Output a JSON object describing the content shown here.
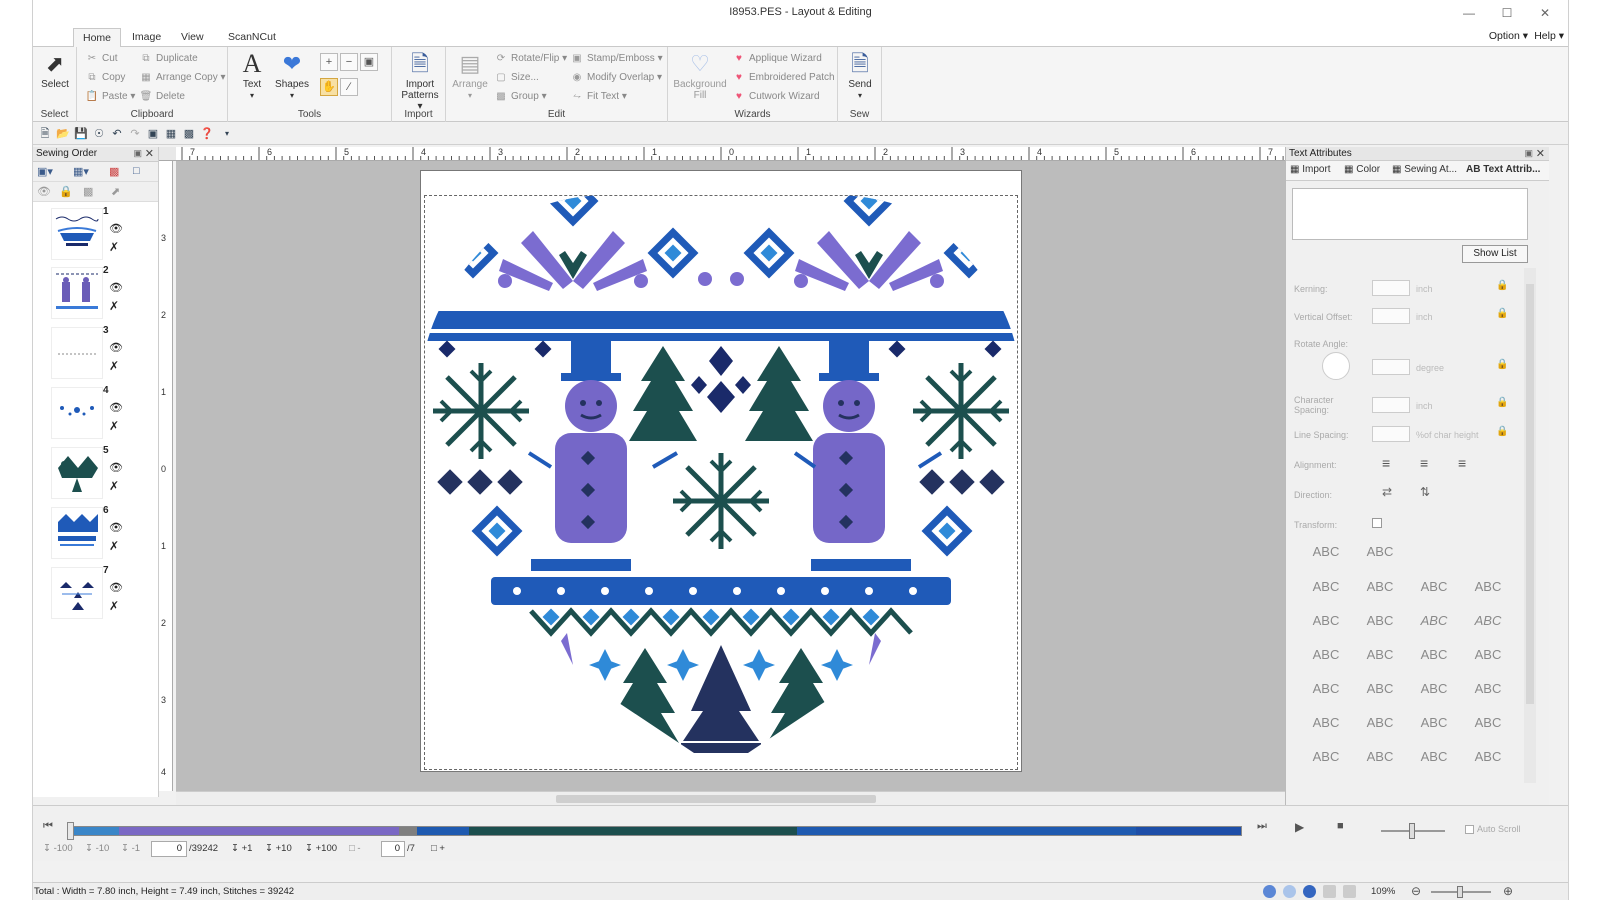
{
  "window": {
    "title": "I8953.PES - Layout & Editing"
  },
  "tabs": [
    "Home",
    "Image",
    "View",
    "ScanNCut"
  ],
  "menus": {
    "option": "Option",
    "help": "Help"
  },
  "ribbon": {
    "select": {
      "button": "Select",
      "group": "Select"
    },
    "clipboard": {
      "cut": "Cut",
      "copy": "Copy",
      "paste": "Paste",
      "duplicate": "Duplicate",
      "arrange_copy": "Arrange Copy",
      "delete": "Delete",
      "group": "Clipboard"
    },
    "tools": {
      "text": "Text",
      "shapes": "Shapes",
      "group": "Tools"
    },
    "import": {
      "button": "Import Patterns",
      "group": "Import"
    },
    "edit": {
      "arrange": "Arrange",
      "rotate_flip": "Rotate/Flip",
      "size": "Size...",
      "group_btn": "Group",
      "stamp_emboss": "Stamp/Emboss",
      "modify_overlap": "Modify Overlap",
      "fit_text": "Fit Text",
      "group": "Edit"
    },
    "wizards": {
      "background_fill": "Background Fill",
      "applique": "Applique Wizard",
      "embroidered_patch": "Embroidered Patch",
      "cutwork": "Cutwork Wizard",
      "group": "Wizards"
    },
    "sew": {
      "send": "Send",
      "group": "Sew"
    }
  },
  "sewing_order": {
    "title": "Sewing Order",
    "items": [
      {
        "num": "1"
      },
      {
        "num": "2"
      },
      {
        "num": "3"
      },
      {
        "num": "4"
      },
      {
        "num": "5"
      },
      {
        "num": "6"
      },
      {
        "num": "7"
      }
    ]
  },
  "ruler": {
    "h": [
      "7",
      "6",
      "5",
      "4",
      "3",
      "2",
      "1",
      "0",
      "1",
      "2",
      "3",
      "4",
      "5",
      "6",
      "7"
    ],
    "v": [
      "3",
      "2",
      "1",
      "0",
      "1",
      "2",
      "3",
      "4"
    ]
  },
  "text_attributes": {
    "title": "Text Attributes",
    "tabs": [
      "Import",
      "Color",
      "Sewing At...",
      "Text Attrib..."
    ],
    "show_list": "Show List",
    "kerning": "Kerning:",
    "vertical_offset": "Vertical Offset:",
    "rotate_angle": "Rotate Angle:",
    "character_spacing": "Character Spacing:",
    "line_spacing": "Line Spacing:",
    "alignment": "Alignment:",
    "direction": "Direction:",
    "transform": "Transform:",
    "unit_inch": "inch",
    "unit_degree": "degree",
    "unit_char_height": "%of char height",
    "sample": "ABC"
  },
  "timeline": {
    "steps": [
      "-100",
      "-10",
      "-1",
      "+1",
      "+10",
      "+100"
    ],
    "stitch_pos": "0",
    "stitch_total": "/39242",
    "color_pos": "0",
    "color_total": "/7",
    "auto_scroll": "Auto Scroll",
    "colors": [
      "#3a86c8",
      "#7a68c4",
      "#7f7f7f",
      "#1e5ab0",
      "#1c4f4e",
      "#1e5ab0",
      "#1d4ea8"
    ],
    "fractions": [
      0.04,
      0.24,
      0.015,
      0.045,
      0.28,
      0.29,
      0.09
    ]
  },
  "status": {
    "text": "Total : Width = 7.80 inch, Height = 7.49 inch, Stitches = 39242",
    "zoom": "109%"
  }
}
